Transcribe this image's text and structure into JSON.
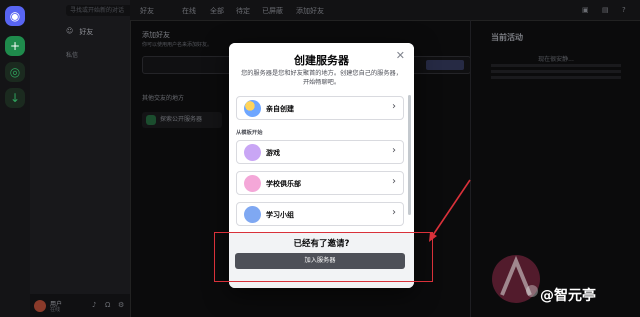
{
  "background_app": {
    "dm_search_placeholder": "寻找或开始新的对话",
    "friends_label": "好友",
    "topbar_tabs": [
      "好友",
      "在线",
      "全部",
      "待定",
      "已屏蔽",
      "添加好友"
    ],
    "direct_messages_header": "私信",
    "add_friend_title": "添加好友",
    "add_friend_desc": "你可以使用用户名来添加好友。",
    "add_friend_button": "发送好友请求",
    "other_places_title": "其他交友的地方",
    "explore_public": "探索公开服务器",
    "activity_title": "当前活动",
    "activity_sub": "现在很安静...",
    "user_name": "用户",
    "user_status": "在线"
  },
  "modal": {
    "title": "创建服务器",
    "close_icon": "close-icon",
    "description": "您的服务器是您和好友聚首的地方。创建您自己的服务器，开始畅聊吧。",
    "create_own": "亲自创建",
    "template_header": "从模板开始",
    "templates": [
      "游戏",
      "学校俱乐部",
      "学习小组"
    ],
    "footer_question": "已经有了邀请?",
    "join_button": "加入服务器"
  },
  "colors": {
    "annotation": "#d9313a",
    "modal_bg": "#ffffff",
    "join_button": "#4e5058"
  },
  "watermark": {
    "text": "@智元亭"
  }
}
